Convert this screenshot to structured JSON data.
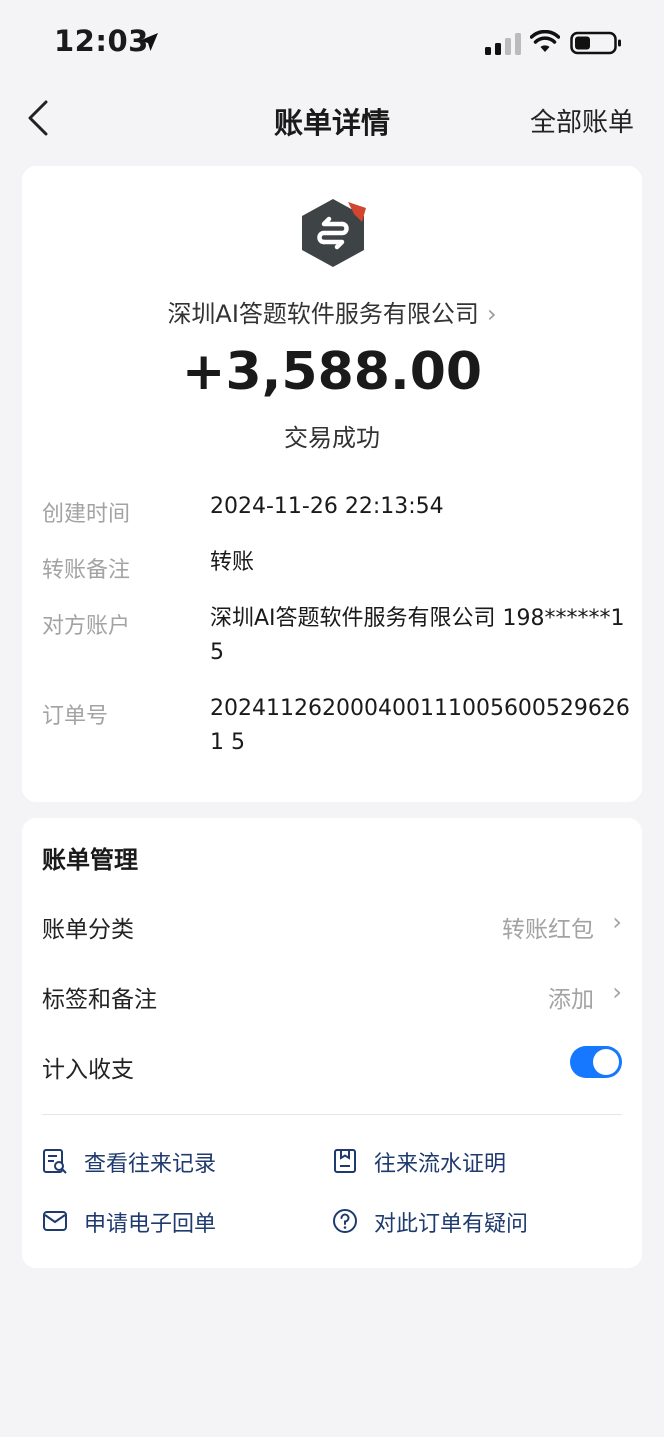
{
  "status_bar": {
    "time": "12:03"
  },
  "nav": {
    "title": "账单详情",
    "right_action": "全部账单"
  },
  "transaction": {
    "merchant_name": "深圳AI答题软件服务有限公司",
    "amount": "+3,588.00",
    "status": "交易成功"
  },
  "details": [
    {
      "label": "创建时间",
      "value": "2024-11-26 22:13:54"
    },
    {
      "label": "转账备注",
      "value": "转账"
    },
    {
      "label": "对方账户",
      "value": "深圳AI答题软件服务有限公司 198******15"
    },
    {
      "label": "订单号",
      "value": "2024112620004001110056005296261 5"
    }
  ],
  "management": {
    "title": "账单管理",
    "category": {
      "label": "账单分类",
      "value": "转账红包"
    },
    "tags": {
      "label": "标签和备注",
      "value": "添加"
    },
    "count_in": {
      "label": "计入收支",
      "enabled": true
    }
  },
  "actions": [
    {
      "label": "查看往来记录",
      "icon": "records-icon"
    },
    {
      "label": "往来流水证明",
      "icon": "statement-icon"
    },
    {
      "label": "申请电子回单",
      "icon": "mail-icon"
    },
    {
      "label": "对此订单有疑问",
      "icon": "question-icon"
    }
  ],
  "colors": {
    "accent": "#1677ff",
    "action_text": "#1f3a6e",
    "background": "#f4f4f6"
  }
}
